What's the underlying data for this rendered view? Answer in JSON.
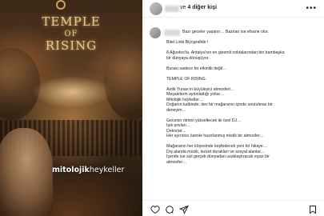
{
  "media": {
    "title_line1": "TEMPLE",
    "title_line2": "OF",
    "title_line3": "RISING",
    "watermark_bold": "mitolojik",
    "watermark_light": "heykeller"
  },
  "header": {
    "connector": "ve",
    "others": "4 diğer kişi",
    "more_icon": "more-horizontal-icon"
  },
  "caption": {
    "lines": [
      "Bazı geceler yaşanır… Bazıları ise efsane olur.",
      "",
      "Bilet Linki Biyografide !",
      "",
      "8 Ağustos'ta, Antalya'nın en gizemli noktalarından biri bambaşka",
      "bir dünyaya dönüşüyor.",
      "",
      "Burası sadece bir etkinlik değil…",
      "",
      "TEMPLE OF RISING.",
      "",
      "Antik Yunan'ın büyüleyici atmosferi…",
      "Meşalelerin aydınlattığı yollar…",
      "Mitolojik heykeller…",
      "Doğanın kalbinde, dev bir mağaranın içinde unutulmaz bir",
      "deneyim…",
      "",
      "Gecenin ritmini yükseltecek iki özel DJ…",
      "Işık şovları…",
      "Dekorlar…",
      "Her ayrıntısı özenle hazırlanmış mistik bir atmosfer…",
      "",
      "Mağaranın her köşesinde keşfedecek yeni bir hikaye…",
      "Dış alanda müzik, lezzet durakları ve sosyal alanlar…",
      "İçeride ise sizi gerçek dünyadan uzaklaştıracak eşsiz bir",
      "atmosfer…"
    ]
  },
  "actions": {
    "like_icon": "heart-icon",
    "comment_icon": "comment-icon",
    "share_icon": "send-icon",
    "save_icon": "bookmark-icon"
  }
}
